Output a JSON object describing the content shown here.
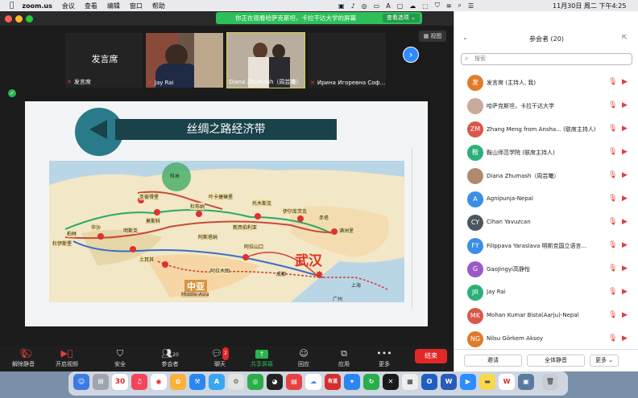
{
  "menubar": {
    "app": "zoom.us",
    "menus": [
      "会议",
      "查看",
      "编辑",
      "窗口",
      "帮助"
    ],
    "clock": "11月30日 周二 下午4:25"
  },
  "banner": {
    "message": "你正在观看哈萨克斯坦，卡拉干达大学的屏幕",
    "options_label": "查看选项 ⌄"
  },
  "view_label": "视图",
  "thumbnails": [
    {
      "center_text": "发言席",
      "name": "发言席"
    },
    {
      "center_text": "",
      "name": "Jay Rai"
    },
    {
      "center_text": "",
      "name": "Diana Zhumash（周芸曦）"
    },
    {
      "center_text": "",
      "name": "Ирина Игоревна Соф..."
    }
  ],
  "slide": {
    "title": "丝绸之路经济带",
    "map_labels": {
      "big_city": "武汉",
      "central_asia": "中亚",
      "central_asia_en": "Middle-Asia",
      "shanghai": "上海",
      "guangzhou": "广州",
      "chengdu": "成都",
      "alashankou": "阿拉山口",
      "kemi": "科米",
      "moscow": "莫斯科",
      "dubna": "杜布纳",
      "yekaterinburg": "叶卡捷琳堡",
      "tomsk": "托木斯克",
      "irkutsk": "伊尔库茨克",
      "chita": "赤塔",
      "manzhouli": "满洲里",
      "novosibirsk": "新西伯利亚",
      "astana": "阿斯塔纳",
      "stpetersburg": "圣彼得堡",
      "minsk": "明斯克",
      "warsaw": "华沙",
      "berlin": "柏林",
      "duisburg": "杜伊斯堡",
      "istanbul": "土耳其",
      "almaty": "阿拉木图"
    }
  },
  "toolbar": {
    "unmute": "解除静音",
    "video": "开启视频",
    "security": "安全",
    "participants": "参会者",
    "participants_count": "20",
    "chat": "聊天",
    "chat_badge": "2",
    "share": "共享屏幕",
    "reactions": "回应",
    "apps": "应用",
    "more": "更多",
    "end": "结束"
  },
  "panel": {
    "title": "参会者 (20)",
    "search_placeholder": "搜索",
    "participants": [
      {
        "initials": "发",
        "name": "发言席 (主持人, 我)",
        "color": "#e07b2a"
      },
      {
        "initials": "",
        "name": "哈萨克斯坦，卡拉干达大学",
        "color": "#c9a99a"
      },
      {
        "initials": "ZM",
        "name": "Zhang Meng from Ansha... (联席主持人)",
        "color": "#d9574a"
      },
      {
        "initials": "鞍",
        "name": "鞍山师范学院 (联席主持人)",
        "color": "#2bb07a"
      },
      {
        "initials": "",
        "name": "Diana Zhumash（周芸曦）",
        "color": "#b08a6e"
      },
      {
        "initials": "A",
        "name": "Agnipunja-Nepal",
        "color": "#3a8ee6"
      },
      {
        "initials": "CY",
        "name": "Cihan Yavuzcan",
        "color": "#4a5560"
      },
      {
        "initials": "FY",
        "name": "Filippava Yaraslava 明斯克国立语言...",
        "color": "#3a8ee6"
      },
      {
        "initials": "G",
        "name": "GaoJingyi高静怡",
        "color": "#9b59c6"
      },
      {
        "initials": "JR",
        "name": "Jay Rai",
        "color": "#2bb07a"
      },
      {
        "initials": "MK",
        "name": "Mohan Kumar Bista(Aarju)-Nepal",
        "color": "#d9574a"
      },
      {
        "initials": "NG",
        "name": "Nilsu Görkem Aksoy",
        "color": "#e07b2a"
      }
    ],
    "invite": "邀请",
    "mute_all": "全体静音",
    "more": "更多 ⌄"
  },
  "dock": {
    "calendar_day": "30",
    "wps_label": "W",
    "youdao": "有道"
  }
}
